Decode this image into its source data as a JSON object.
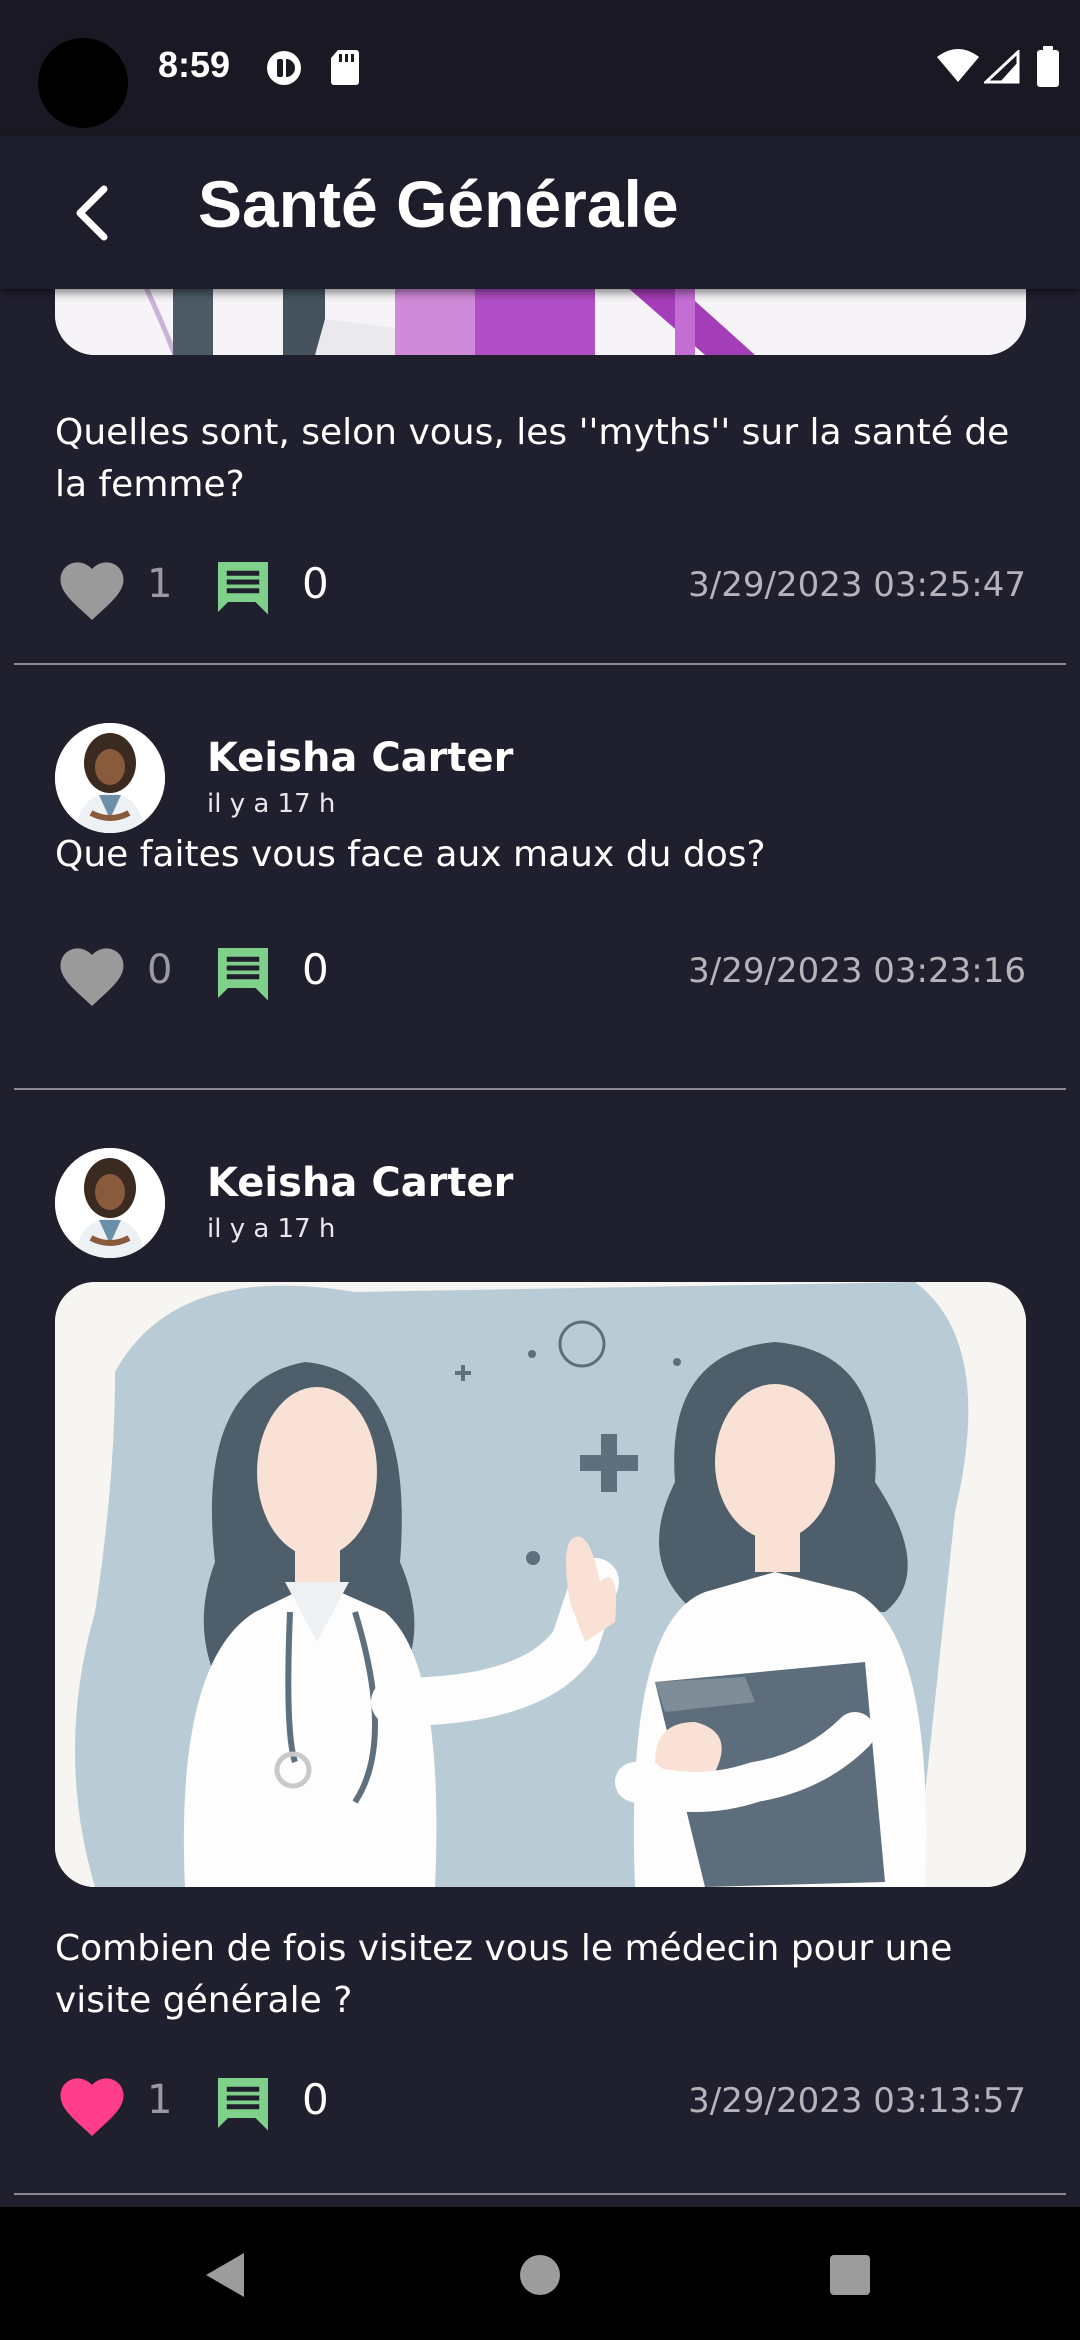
{
  "status_bar": {
    "time": "8:59",
    "icons": [
      "data-saver-icon",
      "sd-card-icon",
      "wifi-icon",
      "signal-icon",
      "battery-icon"
    ]
  },
  "app_bar": {
    "title": "Santé Générale",
    "back_icon": "chevron-left-icon"
  },
  "posts": [
    {
      "text": "Quelles sont, selon vous, les ''myths'' sur la santé de la femme?",
      "likes": "1",
      "liked": false,
      "comments": "0",
      "timestamp": "3/29/2023 03:25:47"
    },
    {
      "author": "Keisha Carter",
      "relative_time": "il y a 17 h",
      "text": "Que faites vous face aux maux du dos?",
      "likes": "0",
      "liked": false,
      "comments": "0",
      "timestamp": "3/29/2023 03:23:16"
    },
    {
      "author": "Keisha Carter",
      "relative_time": "il y a 17 h",
      "text": "Combien de fois visitez vous le médecin pour une visite générale ?",
      "likes": "1",
      "liked": true,
      "comments": "0",
      "timestamp": "3/29/2023 03:13:57"
    }
  ],
  "colors": {
    "background": "#201f2e",
    "app_bar": "#1e1d2b",
    "like_inactive": "#9a9a9a",
    "like_active": "#ff3d8a",
    "comment_icon": "#7fd08a"
  },
  "nav_bar": {
    "icons": [
      "back-triangle-icon",
      "home-circle-icon",
      "recents-square-icon"
    ]
  }
}
